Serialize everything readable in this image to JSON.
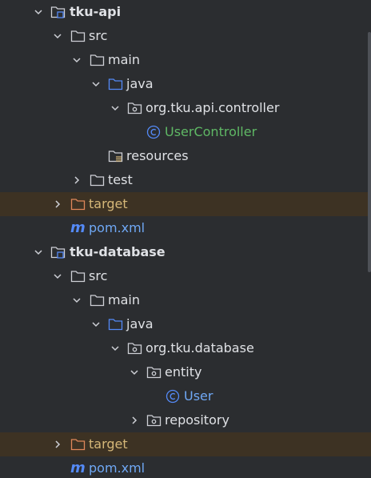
{
  "project_tree": {
    "modules": [
      {
        "name": "tku-api",
        "src": "src",
        "main": "main",
        "java": "java",
        "package": "org.tku.api.controller",
        "class_name": "UserController",
        "resources": "resources",
        "test": "test",
        "target": "target",
        "pom": "pom.xml"
      },
      {
        "name": "tku-database",
        "src": "src",
        "main": "main",
        "java": "java",
        "package": "org.tku.database",
        "entity": "entity",
        "class_name": "User",
        "repository": "repository",
        "target": "target",
        "pom": "pom.xml"
      }
    ]
  },
  "colors": {
    "background": "#2b2d30",
    "excluded_row": "#3d3223",
    "class_text": "#5fb865",
    "excluded_text": "#d5b778",
    "pom_text": "#6fa8f5",
    "folder_stroke": "#ced0d6",
    "source_root": "#548af7",
    "excluded_folder": "#e0875a",
    "class_icon": "#548af7"
  }
}
